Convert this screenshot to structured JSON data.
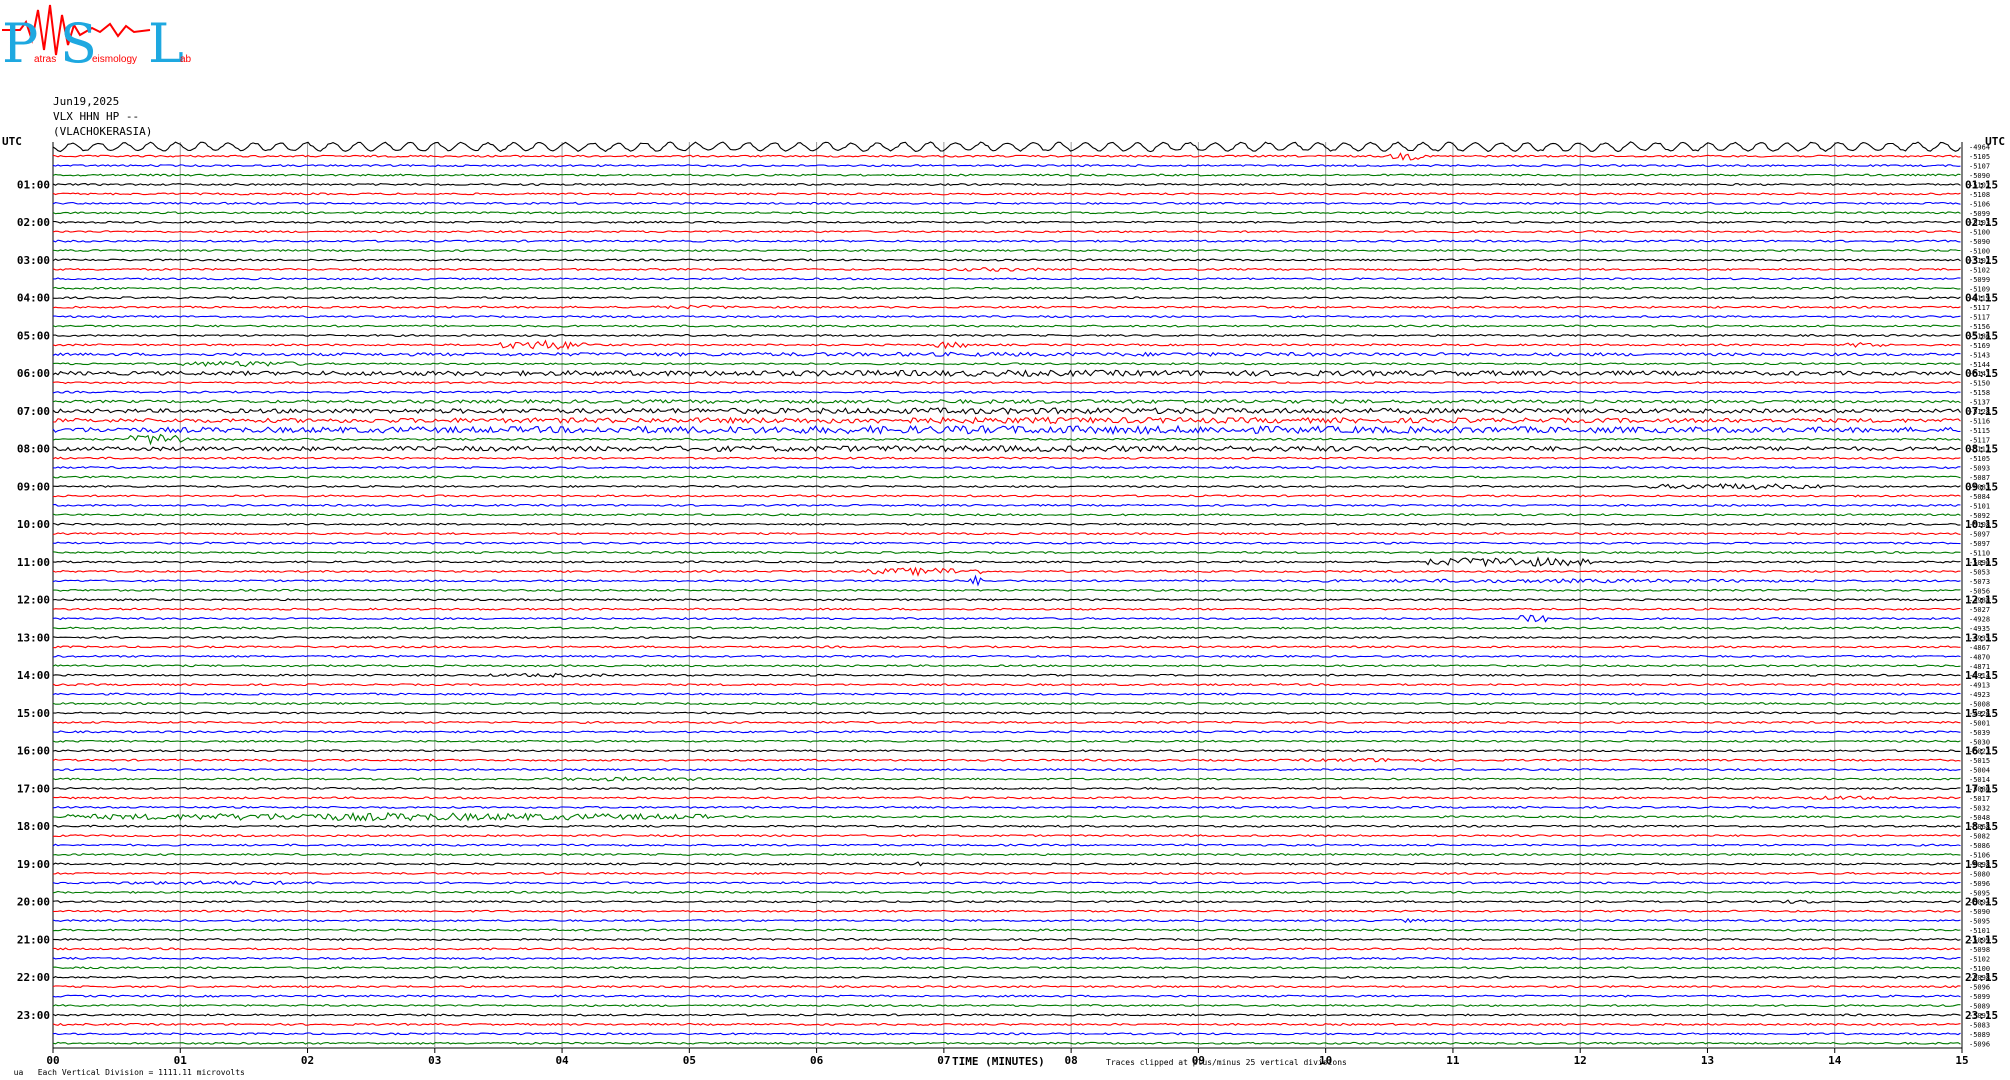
{
  "header": {
    "date": "Jun19,2025",
    "station": "VLX HHN HP --",
    "location": "(VLACHOKERASIA)"
  },
  "logo": {
    "initials": [
      "P",
      "S",
      "L"
    ],
    "words": [
      "atras",
      "eismology",
      "ab"
    ]
  },
  "footer": {
    "scale_note": "Each Vertical Division = 1111.11 microvolts",
    "clip_note": "Traces clipped at plus/minus 25 vertical divisions",
    "corner_mark": "ua"
  },
  "chart_data": {
    "type": "line",
    "xlabel": "TIME (MINUTES)",
    "x_ticks": [
      "00",
      "01",
      "02",
      "03",
      "04",
      "05",
      "06",
      "07",
      "08",
      "09",
      "10",
      "11",
      "12",
      "13",
      "14",
      "15"
    ],
    "xlim": [
      0,
      15
    ],
    "left_axis_label": "UTC",
    "right_axis_label": "UTC",
    "left_hour_labels": [
      "01:00",
      "02:00",
      "03:00",
      "04:00",
      "05:00",
      "06:00",
      "07:00",
      "08:00",
      "09:00",
      "10:00",
      "11:00",
      "12:00",
      "13:00",
      "14:00",
      "15:00",
      "16:00",
      "17:00",
      "18:00",
      "19:00",
      "20:00",
      "21:00",
      "22:00",
      "23:00"
    ],
    "right_hour_labels": [
      "01:15",
      "02:15",
      "03:15",
      "04:15",
      "05:15",
      "06:15",
      "07:15",
      "08:15",
      "09:15",
      "10:15",
      "11:15",
      "12:15",
      "13:15",
      "14:15",
      "15:15",
      "16:15",
      "17:15",
      "18:15",
      "19:15",
      "20:15",
      "21:15",
      "22:15",
      "23:15"
    ],
    "traces_per_hour": 4,
    "trace_color_cycle": [
      "#000000",
      "#ff0000",
      "#0000ff",
      "#007a00"
    ],
    "trace_offsets": [
      "-4964",
      "-5105",
      "-5107",
      "-5090",
      "-5102",
      "-5108",
      "-5106",
      "-5099",
      "-5103",
      "-5100",
      "-5090",
      "-5100",
      "-5102",
      "-5102",
      "-5099",
      "-5109",
      "-5119",
      "-5117",
      "-5117",
      "-5156",
      "-5186",
      "-5169",
      "-5143",
      "-5144",
      "-5141",
      "-5150",
      "-5158",
      "-5137",
      "-5128",
      "-5116",
      "-5115",
      "-5117",
      "-5112",
      "-5105",
      "-5093",
      "-5087",
      "-5083",
      "-5084",
      "-5101",
      "-5092",
      "-5108",
      "-5097",
      "-5097",
      "-5110",
      "-5090",
      "-5053",
      "-5073",
      "-5056",
      "-4988",
      "-5027",
      "-4928",
      "-4935",
      "-4935",
      "-4867",
      "-4870",
      "-4871",
      "-4914",
      "-4913",
      "-4923",
      "-5008",
      "-4926",
      "-5001",
      "-5039",
      "-5030",
      "-5023",
      "-5015",
      "-5004",
      "-5014",
      "-5080",
      "-5017",
      "-5032",
      "-5048",
      "-5068",
      "-5082",
      "-5086",
      "-5106",
      "-5098",
      "-5080",
      "-5096",
      "-5095",
      "-5094",
      "-5090",
      "-5095",
      "-5101",
      "-5099",
      "-5098",
      "-5102",
      "-5100",
      "-5098",
      "-5096",
      "-5099",
      "-5089",
      "-5092",
      "-5083",
      "-5089",
      "-5096"
    ],
    "events": [
      {
        "trace": 1,
        "start_min": 10.5,
        "end_min": 10.8,
        "amp": 4
      },
      {
        "trace": 13,
        "start_min": 7.0,
        "end_min": 7.8,
        "amp": 2
      },
      {
        "trace": 17,
        "start_min": 4.7,
        "end_min": 5.4,
        "amp": 2
      },
      {
        "trace": 21,
        "start_min": 3.5,
        "end_min": 4.2,
        "amp": 5
      },
      {
        "trace": 21,
        "start_min": 6.9,
        "end_min": 7.2,
        "amp": 4
      },
      {
        "trace": 21,
        "start_min": 14.1,
        "end_min": 14.4,
        "amp": 3
      },
      {
        "trace": 22,
        "start_min": 0.0,
        "end_min": 15.0,
        "amp": 2
      },
      {
        "trace": 23,
        "start_min": 1.0,
        "end_min": 2.0,
        "amp": 3
      },
      {
        "trace": 24,
        "start_min": 0.0,
        "end_min": 15.0,
        "amp": 3
      },
      {
        "trace": 27,
        "start_min": 0.0,
        "end_min": 15.0,
        "amp": 2
      },
      {
        "trace": 28,
        "start_min": 0.0,
        "end_min": 15.0,
        "amp": 3
      },
      {
        "trace": 29,
        "start_min": 0.0,
        "end_min": 15.0,
        "amp": 3
      },
      {
        "trace": 30,
        "start_min": 0.0,
        "end_min": 15.0,
        "amp": 4
      },
      {
        "trace": 31,
        "start_min": 0.6,
        "end_min": 1.1,
        "amp": 6
      },
      {
        "trace": 32,
        "start_min": 0.0,
        "end_min": 15.0,
        "amp": 3
      },
      {
        "trace": 36,
        "start_min": 12.5,
        "end_min": 14.0,
        "amp": 3
      },
      {
        "trace": 44,
        "start_min": 10.8,
        "end_min": 12.1,
        "amp": 5
      },
      {
        "trace": 45,
        "start_min": 6.4,
        "end_min": 7.3,
        "amp": 4
      },
      {
        "trace": 46,
        "start_min": 7.2,
        "end_min": 7.3,
        "amp": 5
      },
      {
        "trace": 46,
        "start_min": 9.8,
        "end_min": 13.9,
        "amp": 2
      },
      {
        "trace": 50,
        "start_min": 11.5,
        "end_min": 11.8,
        "amp": 6
      },
      {
        "trace": 56,
        "start_min": 3.4,
        "end_min": 4.4,
        "amp": 2
      },
      {
        "trace": 65,
        "start_min": 9.8,
        "end_min": 10.9,
        "amp": 2
      },
      {
        "trace": 67,
        "start_min": 3.8,
        "end_min": 5.2,
        "amp": 2
      },
      {
        "trace": 69,
        "start_min": 13.7,
        "end_min": 14.5,
        "amp": 2
      },
      {
        "trace": 71,
        "start_min": 0.1,
        "end_min": 5.2,
        "amp": 4
      },
      {
        "trace": 76,
        "start_min": 6.7,
        "end_min": 6.9,
        "amp": 2
      },
      {
        "trace": 78,
        "start_min": 0.5,
        "end_min": 2.2,
        "amp": 2
      },
      {
        "trace": 80,
        "start_min": 13.5,
        "end_min": 13.9,
        "amp": 2
      },
      {
        "trace": 82,
        "start_min": 10.5,
        "end_min": 10.8,
        "amp": 2
      }
    ]
  }
}
